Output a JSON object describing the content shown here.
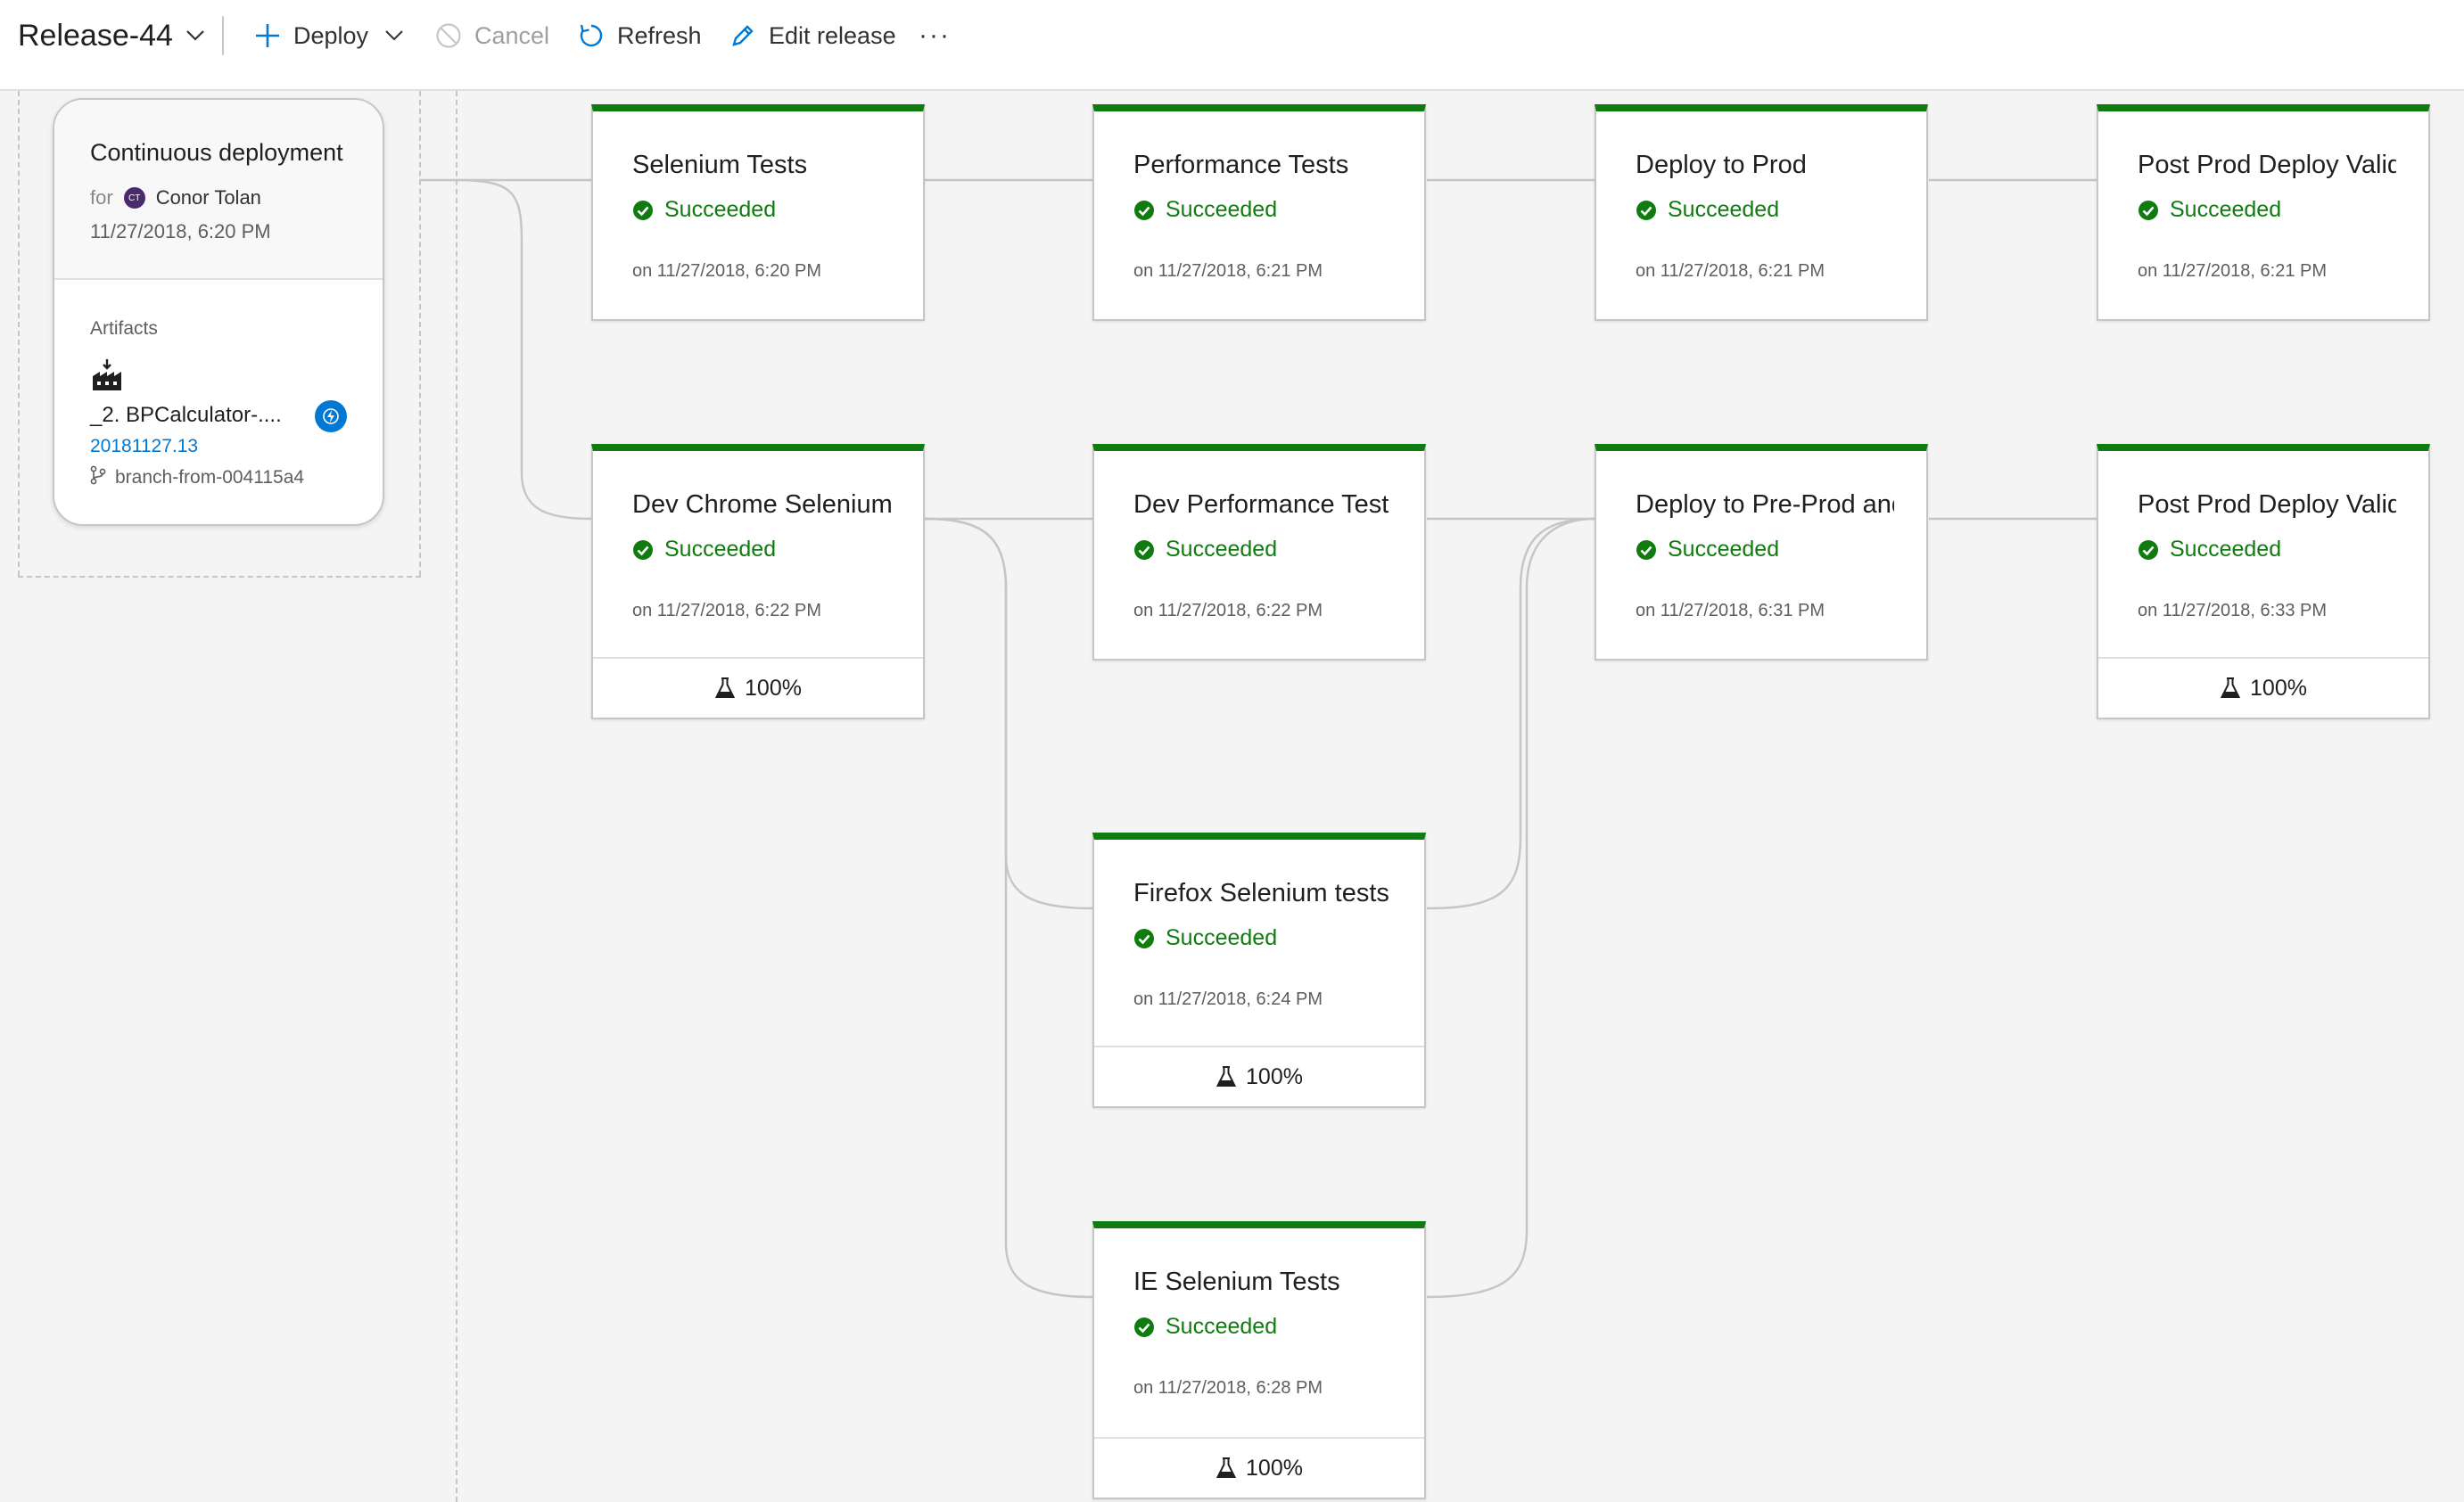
{
  "toolbar": {
    "release_name": "Release-44",
    "deploy_label": "Deploy",
    "cancel_label": "Cancel",
    "refresh_label": "Refresh",
    "edit_label": "Edit release",
    "more_label": "···"
  },
  "trigger": {
    "title": "Continuous deployment",
    "for_label": "for",
    "avatar_initials": "CT",
    "person": "Conor Tolan",
    "date": "11/27/2018, 6:20 PM",
    "artifacts_label": "Artifacts",
    "artifact_name": "_2. BPCalculator-....",
    "artifact_version": "20181127.13",
    "artifact_branch": "branch-from-004115a4"
  },
  "stages": [
    {
      "name": "Selenium Tests",
      "status": "Succeeded",
      "when": "on 11/27/2018, 6:20 PM"
    },
    {
      "name": "Performance Tests",
      "status": "Succeeded",
      "when": "on 11/27/2018, 6:21 PM"
    },
    {
      "name": "Deploy to Prod",
      "status": "Succeeded",
      "when": "on 11/27/2018, 6:21 PM"
    },
    {
      "name": "Post Prod Deploy Validation",
      "status": "Succeeded",
      "when": "on 11/27/2018, 6:21 PM"
    },
    {
      "name": "Dev Chrome Selenium",
      "status": "Succeeded",
      "when": "on 11/27/2018, 6:22 PM",
      "tests": "100%"
    },
    {
      "name": "Dev Performance Test",
      "status": "Succeeded",
      "when": "on 11/27/2018, 6:22 PM"
    },
    {
      "name": "Deploy to Pre-Prod and",
      "status": "Succeeded",
      "when": "on 11/27/2018, 6:31 PM"
    },
    {
      "name": "Post Prod Deploy Validation",
      "status": "Succeeded",
      "when": "on 11/27/2018, 6:33 PM",
      "tests": "100%"
    },
    {
      "name": "Firefox Selenium tests",
      "status": "Succeeded",
      "when": "on 11/27/2018, 6:24 PM",
      "tests": "100%"
    },
    {
      "name": "IE Selenium Tests",
      "status": "Succeeded",
      "when": "on 11/27/2018, 6:28 PM",
      "tests": "100%"
    }
  ],
  "colors": {
    "success": "#107c10",
    "accent": "#0078d4",
    "connector": "#c8c6c4",
    "background": "#f4f4f4"
  },
  "icons": {
    "deploy": "plus-icon",
    "cancel": "cancel-circle-icon",
    "refresh": "refresh-icon",
    "edit": "pencil-icon",
    "status": "check-circle-icon",
    "tests": "flask-icon",
    "artifact": "build-artifact-icon",
    "trigger": "lightning-icon",
    "branch": "branch-icon"
  }
}
